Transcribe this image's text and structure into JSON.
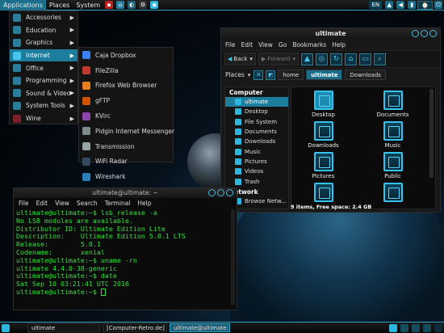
{
  "top_panel": {
    "menus": [
      "Applications",
      "Places",
      "System"
    ],
    "clock": "EN"
  },
  "apps_menu": {
    "items": [
      {
        "label": "Accessories"
      },
      {
        "label": "Education"
      },
      {
        "label": "Graphics"
      },
      {
        "label": "Internet"
      },
      {
        "label": "Office"
      },
      {
        "label": "Programming"
      },
      {
        "label": "Sound & Video"
      },
      {
        "label": "System Tools"
      },
      {
        "label": "Wine"
      }
    ],
    "internet_items": [
      {
        "label": "Caja Dropbox",
        "color": "#3b82f6"
      },
      {
        "label": "FileZilla",
        "color": "#c0392b"
      },
      {
        "label": "Firefox Web Browser",
        "color": "#e67e22"
      },
      {
        "label": "gFTP",
        "color": "#d35400"
      },
      {
        "label": "KVirc",
        "color": "#8e44ad"
      },
      {
        "label": "Pidgin Internet Messenger",
        "color": "#7f8c8d"
      },
      {
        "label": "Transmission",
        "color": "#95a5a6"
      },
      {
        "label": "WiFi Radar",
        "color": "#34495e"
      },
      {
        "label": "Wireshark",
        "color": "#2980b9"
      }
    ]
  },
  "file_manager": {
    "title": "ultimate",
    "menubar": [
      "File",
      "Edit",
      "View",
      "Go",
      "Bookmarks",
      "Help"
    ],
    "back_label": "Back",
    "forward_label": "Forward",
    "places_label": "Places",
    "breadcrumbs": [
      "home",
      "ultimate",
      "Downloads"
    ],
    "sidebar": {
      "computer_head": "Computer",
      "computer_items": [
        "ultimate",
        "Desktop",
        "File System",
        "Documents",
        "Downloads",
        "Music",
        "Pictures",
        "Videos",
        "Trash"
      ],
      "network_head": "Network",
      "network_items": [
        "Browse Netw..."
      ]
    },
    "folders": [
      "Desktop",
      "Documents",
      "Downloads",
      "Music",
      "Pictures",
      "Public",
      "",
      ""
    ],
    "status": "9 items, Free space: 2.4 GB"
  },
  "terminal": {
    "title": "ultimate@ultimate: ~",
    "menubar": [
      "File",
      "Edit",
      "View",
      "Search",
      "Terminal",
      "Help"
    ],
    "lines": [
      "ultimate@ultimate:~$ lsb_release -a",
      "No LSB modules are available.",
      "Distributor ID: Ultimate Edition Lite",
      "Description:    Ultimate Edition 5.0.1 LTS",
      "Release:        5.0.1",
      "Codename:       xenial",
      "ultimate@ultimate:~$ uname -rn",
      "ultimate 4.4.0-38-generic",
      "ultimate@ultimate:~$ date",
      "Sat Sep 10 03:21:41 UTC 2016",
      "ultimate@ultimate:~$ "
    ]
  },
  "bottom_panel": {
    "tasks": [
      "ultimate",
      "[Computer-Retro.de] ...",
      "ultimate@ultimate: ..."
    ]
  }
}
